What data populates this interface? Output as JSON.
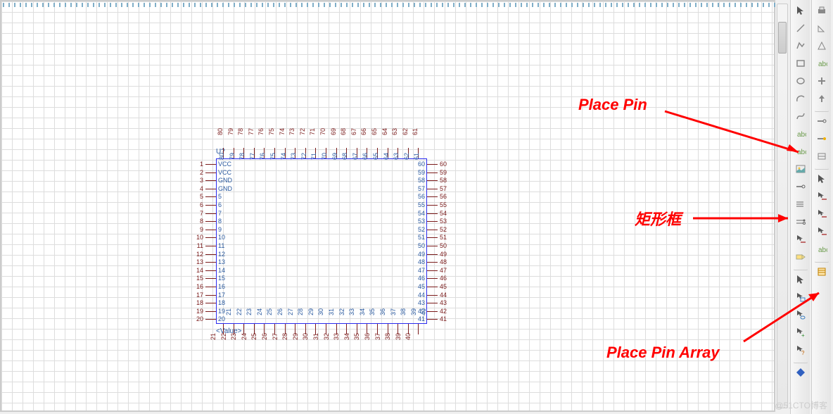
{
  "refdes": "U?",
  "value": "<Value>",
  "annotations": {
    "place_pin": "Place Pin",
    "rect": "矩形框",
    "place_pin_array": "Place Pin Array"
  },
  "watermark": "@51CTO博客",
  "pins": {
    "left": [
      {
        "n": "1",
        "name": "VCC"
      },
      {
        "n": "2",
        "name": "VCC"
      },
      {
        "n": "3",
        "name": "GND"
      },
      {
        "n": "4",
        "name": "GND"
      },
      {
        "n": "5",
        "name": "5"
      },
      {
        "n": "6",
        "name": "6"
      },
      {
        "n": "7",
        "name": "7"
      },
      {
        "n": "8",
        "name": "8"
      },
      {
        "n": "9",
        "name": "9"
      },
      {
        "n": "10",
        "name": "10"
      },
      {
        "n": "11",
        "name": "11"
      },
      {
        "n": "12",
        "name": "12"
      },
      {
        "n": "13",
        "name": "13"
      },
      {
        "n": "14",
        "name": "14"
      },
      {
        "n": "15",
        "name": "15"
      },
      {
        "n": "16",
        "name": "16"
      },
      {
        "n": "17",
        "name": "17"
      },
      {
        "n": "18",
        "name": "18"
      },
      {
        "n": "19",
        "name": "19"
      },
      {
        "n": "20",
        "name": "20"
      }
    ],
    "bottom": [
      {
        "n": "21"
      },
      {
        "n": "22"
      },
      {
        "n": "23"
      },
      {
        "n": "24"
      },
      {
        "n": "25"
      },
      {
        "n": "26"
      },
      {
        "n": "27"
      },
      {
        "n": "28"
      },
      {
        "n": "29"
      },
      {
        "n": "30"
      },
      {
        "n": "31"
      },
      {
        "n": "32"
      },
      {
        "n": "33"
      },
      {
        "n": "34"
      },
      {
        "n": "35"
      },
      {
        "n": "36"
      },
      {
        "n": "37"
      },
      {
        "n": "38"
      },
      {
        "n": "39"
      },
      {
        "n": "40"
      }
    ],
    "right": [
      {
        "n": "41"
      },
      {
        "n": "42"
      },
      {
        "n": "43"
      },
      {
        "n": "44"
      },
      {
        "n": "45"
      },
      {
        "n": "46"
      },
      {
        "n": "47"
      },
      {
        "n": "48"
      },
      {
        "n": "49"
      },
      {
        "n": "50"
      },
      {
        "n": "51"
      },
      {
        "n": "52"
      },
      {
        "n": "53"
      },
      {
        "n": "54"
      },
      {
        "n": "55"
      },
      {
        "n": "56"
      },
      {
        "n": "57"
      },
      {
        "n": "58"
      },
      {
        "n": "59"
      },
      {
        "n": "60"
      }
    ],
    "top": [
      {
        "n": "61"
      },
      {
        "n": "62"
      },
      {
        "n": "63"
      },
      {
        "n": "64"
      },
      {
        "n": "65"
      },
      {
        "n": "66"
      },
      {
        "n": "67"
      },
      {
        "n": "68"
      },
      {
        "n": "69"
      },
      {
        "n": "70"
      },
      {
        "n": "71"
      },
      {
        "n": "72"
      },
      {
        "n": "73"
      },
      {
        "n": "74"
      },
      {
        "n": "75"
      },
      {
        "n": "76"
      },
      {
        "n": "77"
      },
      {
        "n": "78"
      },
      {
        "n": "79"
      },
      {
        "n": "80"
      }
    ]
  },
  "toolbar_a": [
    "cursor",
    "line",
    "poly",
    "rect",
    "oval",
    "arc",
    "bezier",
    "text",
    "text2",
    "image",
    "pin-single",
    "pin-bus",
    "pin-diff",
    "net",
    "port",
    "sep",
    "cursor2",
    "cursor-box",
    "cursor-lasso",
    "cursor-plus",
    "cursor-q",
    "sep",
    "diamond"
  ],
  "toolbar_b": [
    "print",
    "angle",
    "triangle",
    "text-lbl",
    "plus",
    "arrow-up",
    "sep",
    "pin",
    "c-pin",
    "param",
    "sep",
    "pointer",
    "net-cursor",
    "wire-cursor",
    "bus-cursor",
    "text-cursor",
    "sep",
    "pin-array"
  ]
}
